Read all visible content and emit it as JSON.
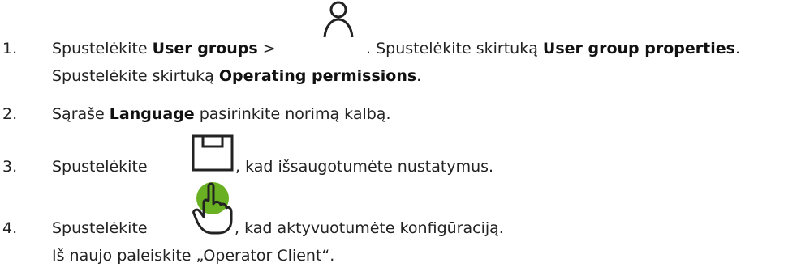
{
  "steps": [
    {
      "number": "1.",
      "segments": [
        "Spustelėkite ",
        "User groups",
        " > ",
        ". Spustelėkite skirtuką ",
        "User group properties",
        "."
      ],
      "line2": [
        "Spustelėkite skirtuką ",
        "Operating permissions",
        "."
      ],
      "icon": "user-icon"
    },
    {
      "number": "2.",
      "segments": [
        "Sąraše ",
        "Language",
        " pasirinkite norimą kalbą."
      ]
    },
    {
      "number": "3.",
      "segments": [
        "Spustelėkite",
        ", kad išsaugotumėte nustatymus."
      ],
      "icon": "save-icon"
    },
    {
      "number": "4.",
      "segments": [
        "Spustelėkite",
        ", kad aktyvuotumėte konfigūraciją."
      ],
      "line2": [
        "Iš naujo paleiskite „Operator Client“."
      ],
      "icon": "activate-hand-icon",
      "icon_color": "#6ab023"
    }
  ]
}
